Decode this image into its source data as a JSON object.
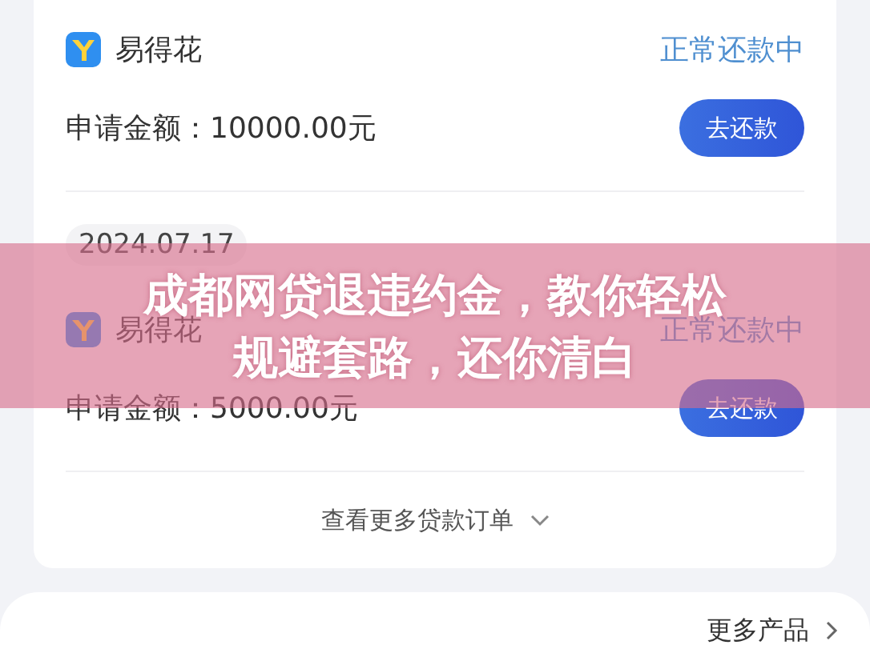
{
  "loans": [
    {
      "lender": "易得花",
      "status": "正常还款中",
      "amount": "申请金额：10000.00元",
      "button": "去还款"
    },
    {
      "date": "2024.07.17",
      "lender": "易得花",
      "status": "正常还款中",
      "amount": "申请金额：5000.00元",
      "button": "去还款"
    }
  ],
  "more_orders": "查看更多贷款订单",
  "more_products": "更多产品",
  "banner": {
    "title_lines": [
      "成都网贷退违约金，教你轻松",
      "规避套路，还你清白"
    ]
  }
}
